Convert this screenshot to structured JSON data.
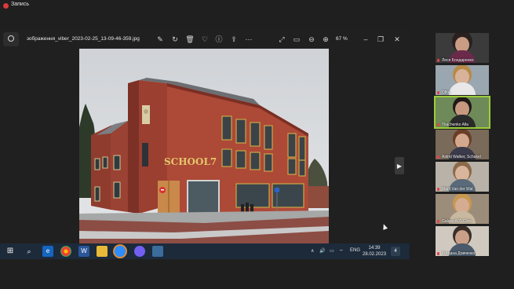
{
  "recording": {
    "label": "Запись"
  },
  "viewer": {
    "file_name": "зображення_viber_2023-02-25_13-09-46-359.jpg",
    "zoom": "67 %",
    "photo_sign": "SCHOOL7"
  },
  "taskbar": {
    "language": "ENG",
    "time": "14:39",
    "date": "28.02.2023",
    "notifications": "4"
  },
  "participants": [
    {
      "name": "Леся Бондаренко"
    },
    {
      "name": "Olha"
    },
    {
      "name": "Tkachenko Alla"
    },
    {
      "name": "Astrid Walker, Schakel"
    },
    {
      "name": "Marit Van der Wal"
    },
    {
      "name": "Galaxy A03 Core"
    },
    {
      "name": "Богдана Довченко"
    }
  ]
}
